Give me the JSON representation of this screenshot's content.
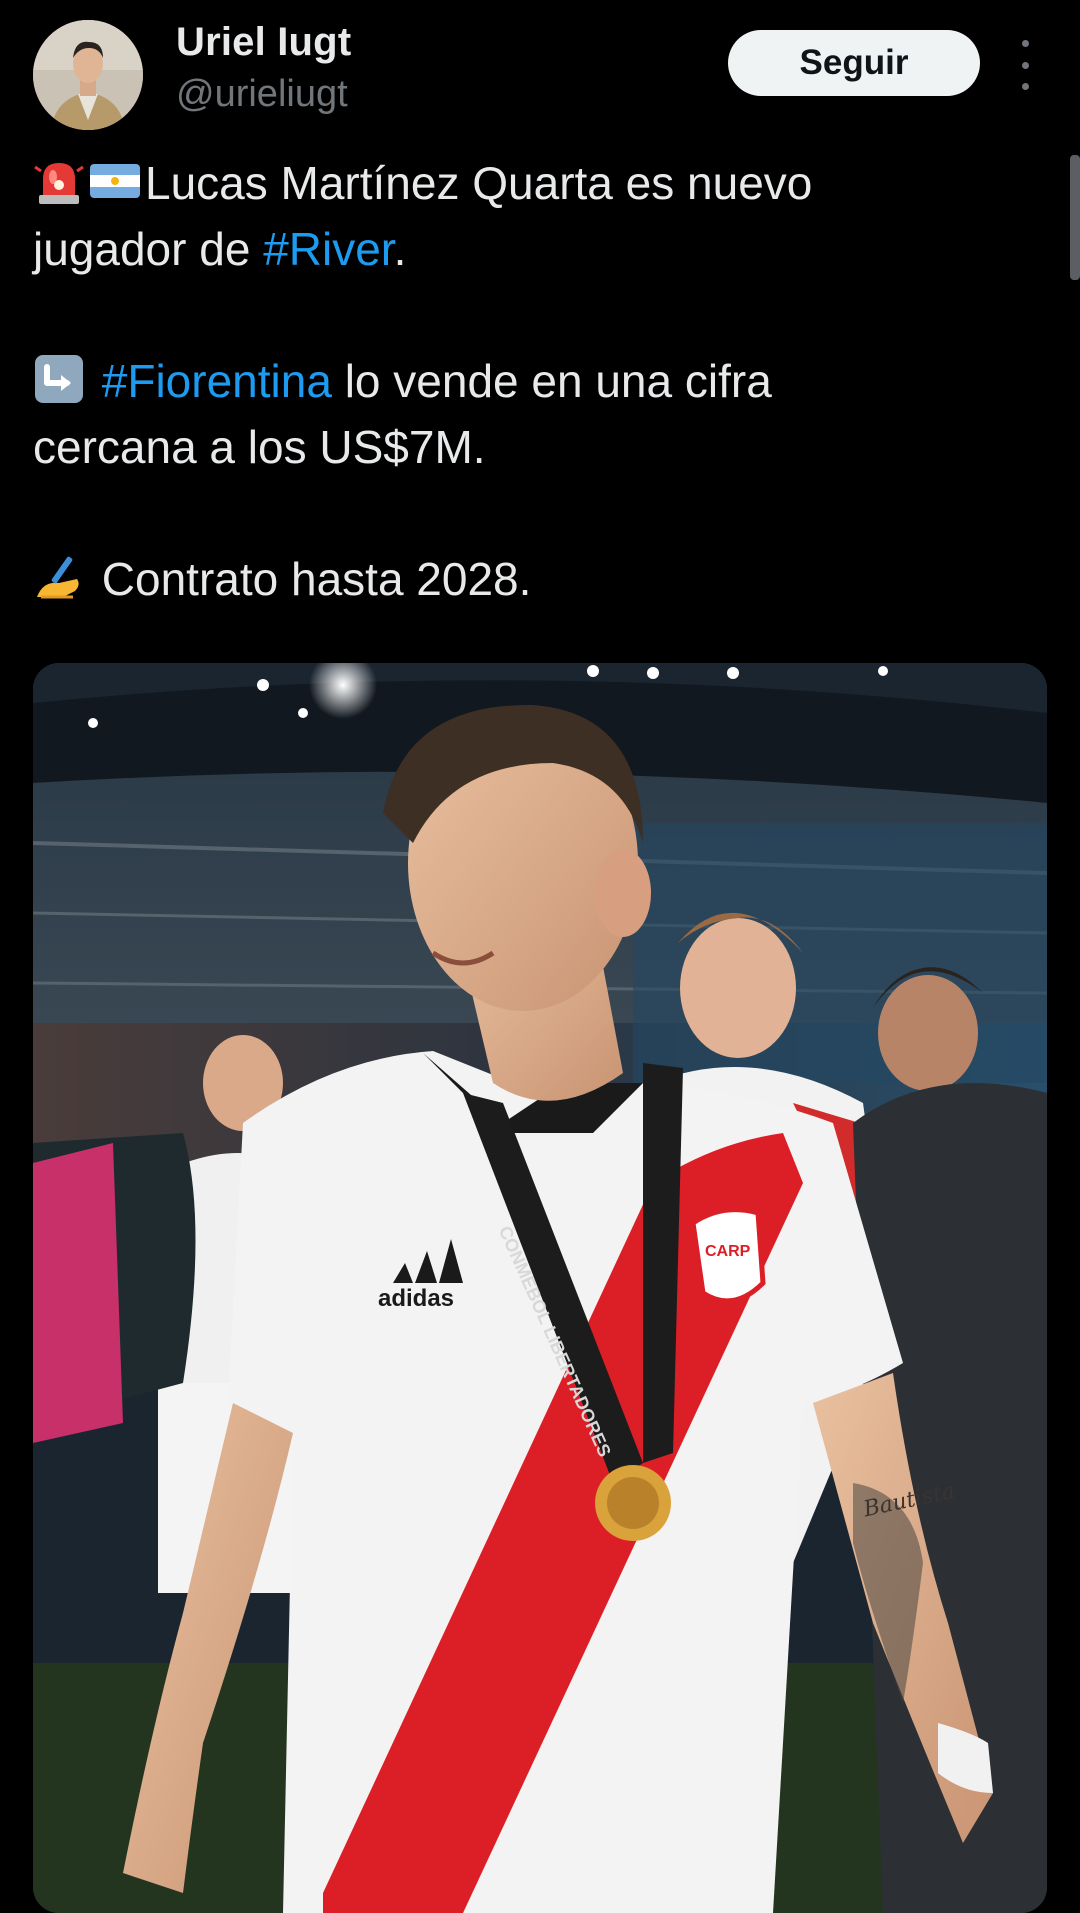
{
  "author": {
    "name": "Uriel Iugt",
    "handle": "@urieliugt"
  },
  "follow_label": "Seguir",
  "tweet": {
    "line1_text": "Lucas Martínez Quarta es nuevo",
    "line2_text": "jugador de ",
    "hashtag_river": "#River",
    "line2_end": ".",
    "hashtag_fiorentina": "#Fiorentina",
    "line3_text": " lo vende en una cifra",
    "line4_text": "cercana a los US$7M.",
    "line5_text": " Contrato hasta 2028."
  },
  "photo": {
    "medal_ribbon_text": "CONMEBOL LIBERTADORES",
    "brand_text": "adidas",
    "crest_text": "CARP",
    "tattoo_text": "Bautista"
  },
  "icons": [
    "siren-icon",
    "argentina-flag-icon",
    "return-arrow-icon",
    "writing-hand-icon",
    "more-options-icon"
  ]
}
